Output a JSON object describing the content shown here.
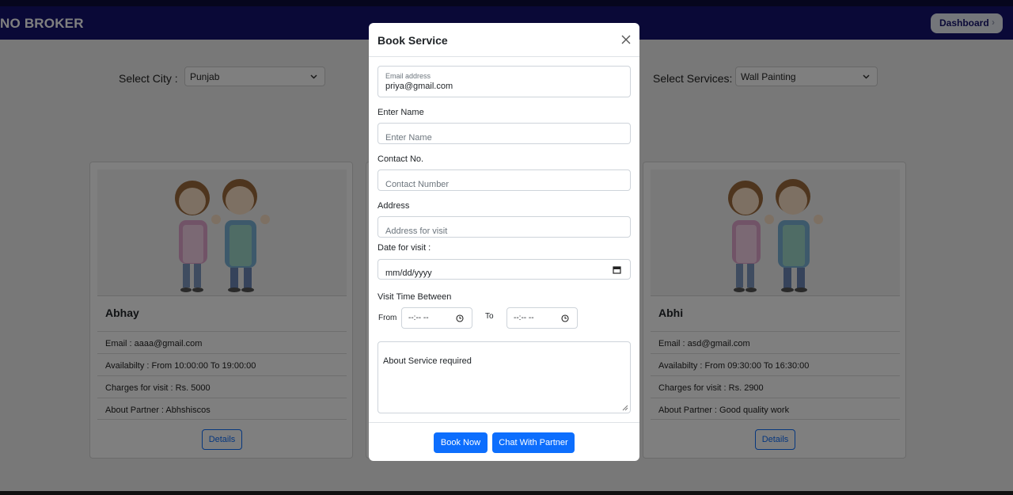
{
  "navbar": {
    "brand": "NO BROKER",
    "dashboard_label": "Dashboard"
  },
  "filters": {
    "city_label": "Select City :",
    "city_value": "Punjab",
    "services_label": "Select Services:",
    "services_value": "Wall Painting"
  },
  "cards": [
    {
      "name": "Abhay",
      "email": "Email : aaaa@gmail.com",
      "availability": "Availabilty : From 10:00:00 To 19:00:00",
      "charges": "Charges for visit : Rs. 5000",
      "about": "About Partner : Abhshiscos",
      "details_label": "Details"
    },
    {
      "name": "Abhi",
      "email": "Email : asd@gmail.com",
      "availability": "Availabilty : From 09:30:00 To 16:30:00",
      "charges": "Charges for visit : Rs. 2900",
      "about": "About Partner : Good quality work",
      "details_label": "Details"
    }
  ],
  "modal": {
    "title": "Book Service",
    "email_label": "Email address",
    "email_value": "priya@gmail.com",
    "name_label": "Enter Name",
    "name_placeholder": "Enter Name",
    "contact_label": "Contact No.",
    "contact_placeholder": "Contact Number",
    "address_label": "Address",
    "address_placeholder": "Address for visit",
    "date_label": "Date for visit :",
    "date_value": "mm/dd/yyyy",
    "time_label": "Visit Time Between",
    "from_label": "From",
    "from_value": "--:-- --",
    "to_label": "To",
    "to_value": "--:-- --",
    "about_placeholder": "About Service required",
    "book_label": "Book Now",
    "chat_label": "Chat With Partner"
  },
  "colors": {
    "navbar": "#14136e",
    "primary": "#0d6efd"
  }
}
